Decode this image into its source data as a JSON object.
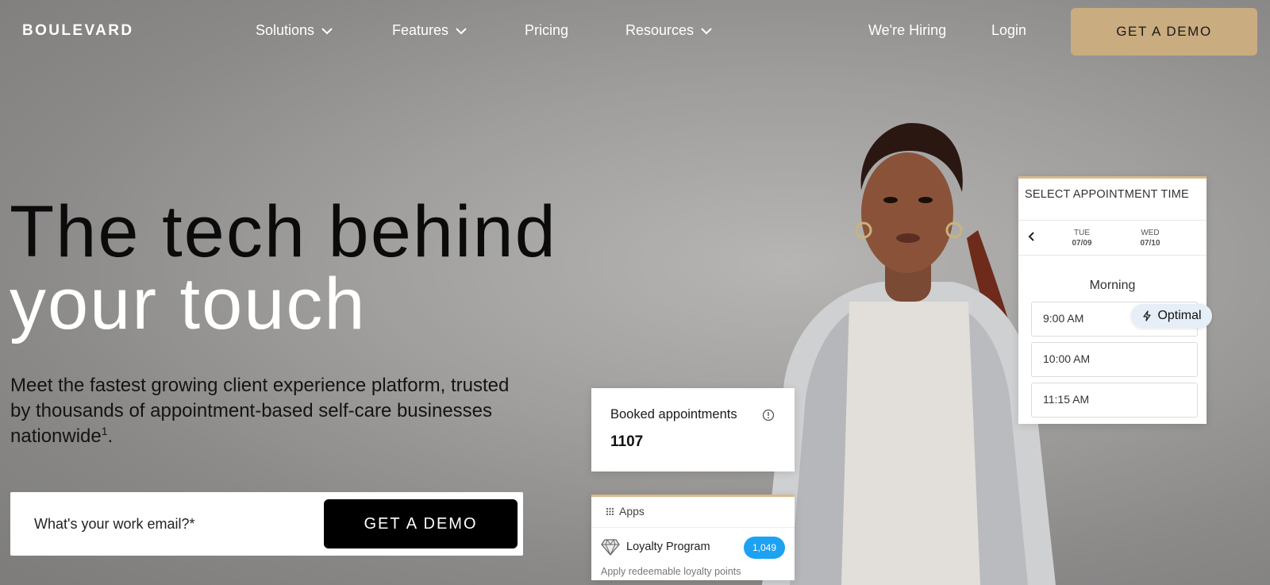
{
  "nav": {
    "logo": "BOULEVARD",
    "items": [
      {
        "label": "Solutions",
        "has_dropdown": true
      },
      {
        "label": "Features",
        "has_dropdown": true
      },
      {
        "label": "Pricing",
        "has_dropdown": false
      },
      {
        "label": "Resources",
        "has_dropdown": true
      }
    ],
    "hiring": "We're Hiring",
    "login": "Login",
    "demo_button": "GET A DEMO"
  },
  "hero": {
    "headline_line1": "The tech behind",
    "headline_line2": "your touch",
    "subheading": "Meet the fastest growing client experience platform, trusted by thousands of appointment-based self-care businesses nationwide",
    "footnote_marker": "1",
    "subheading_end": ".",
    "email_placeholder": "What's your work email?*",
    "demo_button": "GET A DEMO"
  },
  "appointment_card": {
    "title": "SELECT APPOINTMENT TIME",
    "days": [
      {
        "weekday": "TUE",
        "date": "07/09"
      },
      {
        "weekday": "WED",
        "date": "07/10"
      }
    ],
    "section": "Morning",
    "slots": [
      "9:00 AM",
      "10:00 AM",
      "11:15 AM"
    ],
    "optimal_label": "Optimal"
  },
  "booked_card": {
    "label": "Booked appointments",
    "count": "1107"
  },
  "apps_card": {
    "header": "Apps",
    "item_name": "Loyalty Program",
    "badge": "1,049",
    "description": "Apply redeemable loyalty points"
  },
  "colors": {
    "gold_accent": "#c9ac7f",
    "background_gray": "#9e9d9b",
    "badge_blue": "#1da1f2",
    "text_dark": "#0b0b0b"
  },
  "icons": [
    "chevron-down-icon",
    "chevron-left-icon",
    "lightning-icon",
    "info-icon",
    "grid-icon",
    "diamond-icon"
  ]
}
